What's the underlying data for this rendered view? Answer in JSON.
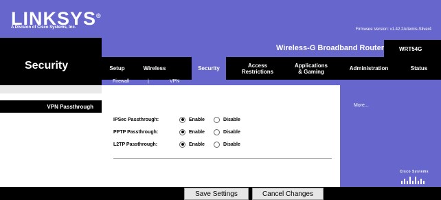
{
  "header": {
    "logo": "LINKSYS",
    "logo_mark": "®",
    "subtitle": "A Division of Cisco Systems, Inc.",
    "firmware": "Firmware Version: v1.42.2Artemis-Silver4",
    "product": "Wireless-G Broadband Router",
    "model": "WRT54G",
    "page_title": "Security"
  },
  "nav": {
    "tabs": [
      {
        "label": "Setup"
      },
      {
        "label": "Wireless"
      },
      {
        "label": "Security"
      },
      {
        "label": "Access\nRestrictions"
      },
      {
        "label": "Applications\n& Gaming"
      },
      {
        "label": "Administration"
      },
      {
        "label": "Status"
      }
    ],
    "subtabs": [
      "Firewall",
      "|",
      "VPN"
    ]
  },
  "section": {
    "title": "VPN Passthrough"
  },
  "options": {
    "enable_label": "Enable",
    "disable_label": "Disable",
    "rows": [
      {
        "label": "IPSec Passthrough:",
        "selected": "enable"
      },
      {
        "label": "PPTP Passthrough:",
        "selected": "enable"
      },
      {
        "label": "L2TP Passthrough:",
        "selected": "enable"
      }
    ]
  },
  "side": {
    "more": "More...",
    "brand": "Cisco Systems"
  },
  "footer": {
    "save": "Save Settings",
    "cancel": "Cancel Changes"
  },
  "colors": {
    "accent": "#6666cc",
    "dark": "#000000"
  }
}
